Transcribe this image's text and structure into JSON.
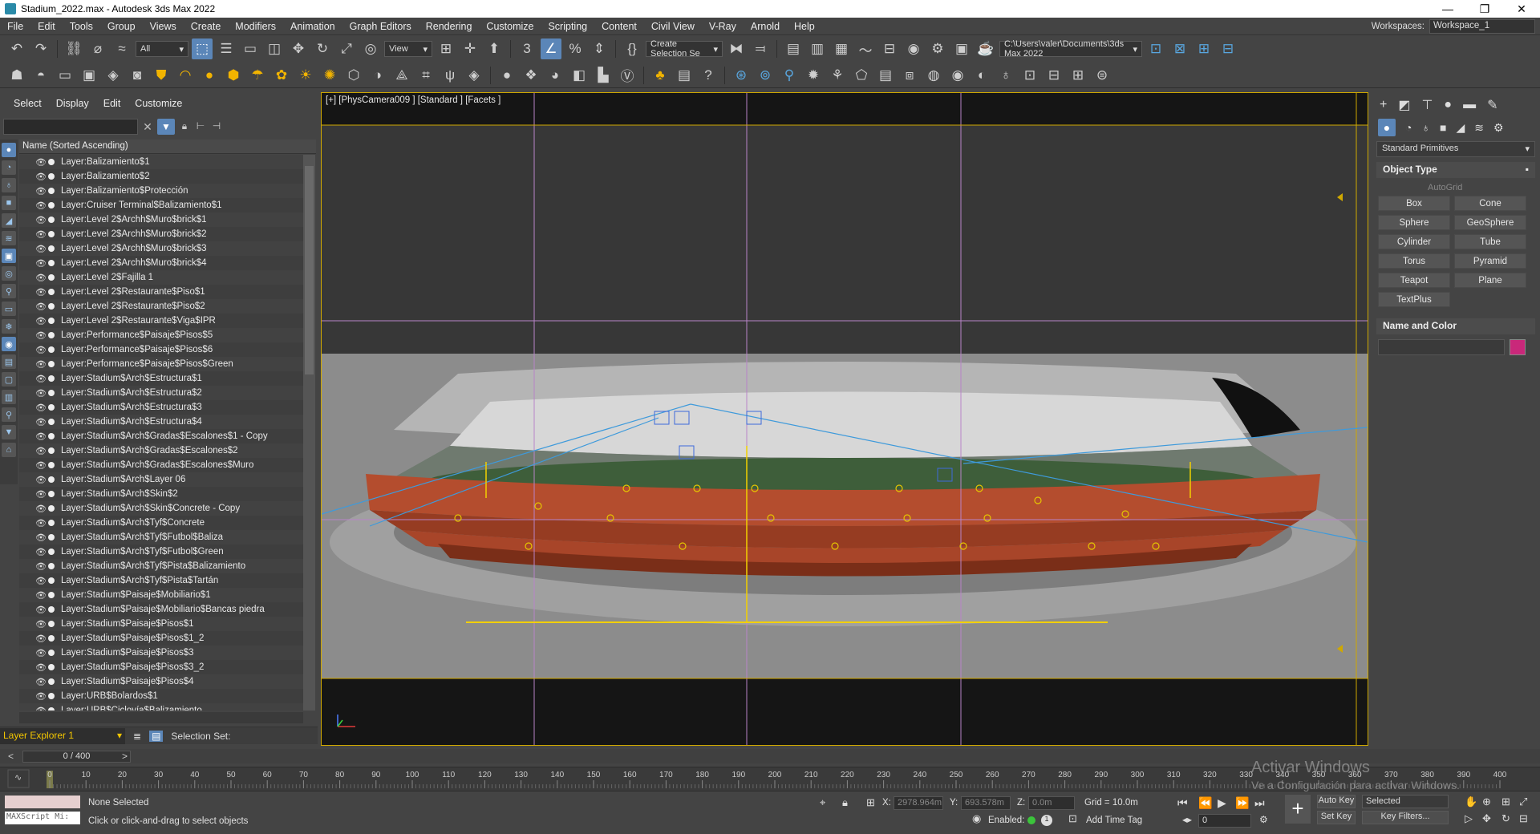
{
  "window": {
    "title": "Stadium_2022.max - Autodesk 3ds Max 2022",
    "min": "—",
    "restore": "❐",
    "close": "✕"
  },
  "menu": [
    "File",
    "Edit",
    "Tools",
    "Group",
    "Views",
    "Create",
    "Modifiers",
    "Animation",
    "Graph Editors",
    "Rendering",
    "Customize",
    "Scripting",
    "Content",
    "Civil View",
    "V-Ray",
    "Arnold",
    "Help"
  ],
  "workspaces": {
    "label": "Workspaces:",
    "value": "Workspace_1"
  },
  "toolbar": {
    "selection_filter": "All",
    "ref_coord": "View",
    "named_selection": "Create Selection Se",
    "path": "C:\\Users\\valer\\Documents\\3ds Max 2022"
  },
  "scene_explorer": {
    "tabs": [
      "Select",
      "Display",
      "Edit",
      "Customize"
    ],
    "column_header": "Name (Sorted Ascending)",
    "layers": [
      "Layer:Balizamiento$1",
      "Layer:Balizamiento$2",
      "Layer:Balizamiento$Protección",
      "Layer:Cruiser Terminal$Balizamiento$1",
      "Layer:Level 2$Archh$Muro$brick$1",
      "Layer:Level 2$Archh$Muro$brick$2",
      "Layer:Level 2$Archh$Muro$brick$3",
      "Layer:Level 2$Archh$Muro$brick$4",
      "Layer:Level 2$Fajilla 1",
      "Layer:Level 2$Restaurante$Piso$1",
      "Layer:Level 2$Restaurante$Piso$2",
      "Layer:Level 2$Restaurante$Viga$IPR",
      "Layer:Performance$Paisaje$Pisos$5",
      "Layer:Performance$Paisaje$Pisos$6",
      "Layer:Performance$Paisaje$Pisos$Green",
      "Layer:Stadium$Arch$Estructura$1",
      "Layer:Stadium$Arch$Estructura$2",
      "Layer:Stadium$Arch$Estructura$3",
      "Layer:Stadium$Arch$Estructura$4",
      "Layer:Stadium$Arch$Gradas$Escalones$1 - Copy",
      "Layer:Stadium$Arch$Gradas$Escalones$2",
      "Layer:Stadium$Arch$Gradas$Escalones$Muro",
      "Layer:Stadium$Arch$Layer 06",
      "Layer:Stadium$Arch$Skin$2",
      "Layer:Stadium$Arch$Skin$Concrete - Copy",
      "Layer:Stadium$Arch$Tyf$Concrete",
      "Layer:Stadium$Arch$Tyf$Futbol$Baliza",
      "Layer:Stadium$Arch$Tyf$Futbol$Green",
      "Layer:Stadium$Arch$Tyf$Pista$Balizamiento",
      "Layer:Stadium$Arch$Tyf$Pista$Tartán",
      "Layer:Stadium$Paisaje$Mobiliario$1",
      "Layer:Stadium$Paisaje$Mobiliario$Bancas piedra",
      "Layer:Stadium$Paisaje$Pisos$1",
      "Layer:Stadium$Paisaje$Pisos$1_2",
      "Layer:Stadium$Paisaje$Pisos$3",
      "Layer:Stadium$Paisaje$Pisos$3_2",
      "Layer:Stadium$Paisaje$Pisos$4",
      "Layer:URB$Bolardos$1",
      "Layer:URB$Ciclovía$Balizamiento"
    ],
    "explorer_name": "Layer Explorer 1",
    "selection_set_label": "Selection Set:"
  },
  "viewport": {
    "label": "[+] [PhysCamera009 ] [Standard ] [Facets ]"
  },
  "command_panel": {
    "category": "Standard Primitives",
    "object_type_header": "Object Type",
    "autogrid": "AutoGrid",
    "primitives": [
      "Box",
      "Cone",
      "Sphere",
      "GeoSphere",
      "Cylinder",
      "Tube",
      "Torus",
      "Pyramid",
      "Teapot",
      "Plane",
      "TextPlus"
    ],
    "name_color_header": "Name and Color",
    "color": "#c9287a"
  },
  "timeline": {
    "frame": "0 / 400",
    "ticks": [
      "0",
      "10",
      "20",
      "30",
      "40",
      "50",
      "60",
      "70",
      "80",
      "90",
      "100",
      "110",
      "120",
      "130",
      "140",
      "150",
      "160",
      "170",
      "180",
      "190",
      "200",
      "210",
      "220",
      "230",
      "240",
      "250",
      "260",
      "270",
      "280",
      "290",
      "300",
      "310",
      "320",
      "330",
      "340",
      "350",
      "360",
      "370",
      "380",
      "390",
      "400"
    ]
  },
  "status": {
    "maxscript": "MAXScript Mi:",
    "selection": "None Selected",
    "prompt": "Click or click-and-drag to select objects",
    "x_label": "X:",
    "x": "2978.964m",
    "y_label": "Y:",
    "y": "693.578m",
    "z_label": "Z:",
    "z": "0.0m",
    "grid": "Grid = 10.0m",
    "enabled": "Enabled:",
    "add_time_tag": "Add Time Tag",
    "auto_key": "Auto Key",
    "set_key": "Set Key",
    "key_mode": "Selected",
    "key_filters": "Key Filters...",
    "frame_field": "0"
  },
  "watermark": {
    "line1": "Activar Windows",
    "line2": "Ve a Configuración para activar Windows."
  }
}
